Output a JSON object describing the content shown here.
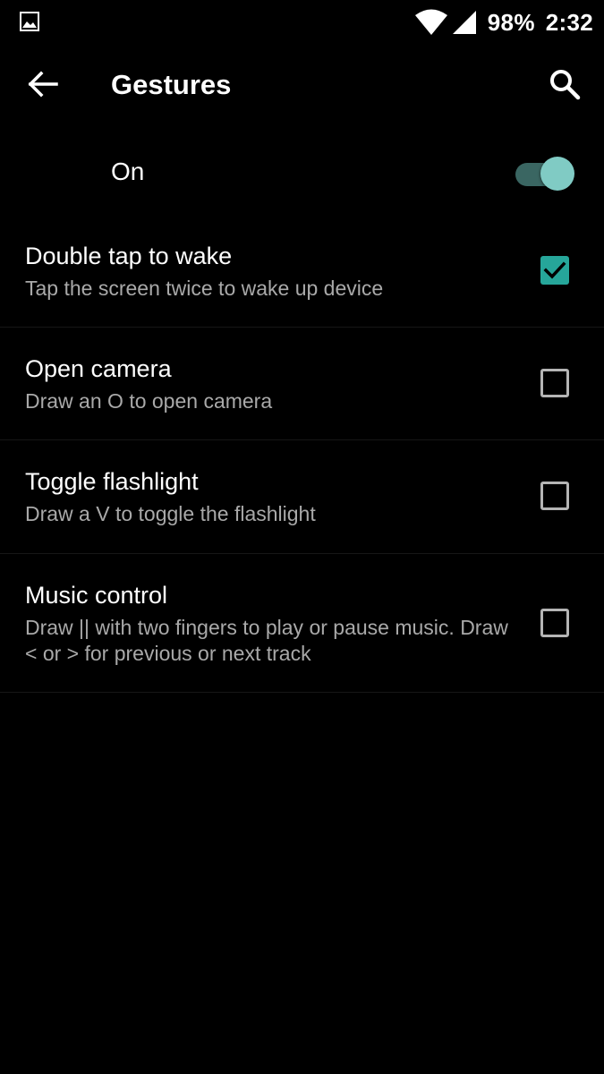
{
  "status_bar": {
    "left_icon": "image-notification-icon",
    "wifi_icon": "wifi-icon",
    "signal_icon": "cell-signal-icon",
    "battery": "98%",
    "time": "2:32"
  },
  "toolbar": {
    "back_icon": "arrow-back-icon",
    "title": "Gestures",
    "search_icon": "search-icon"
  },
  "master_switch": {
    "label": "On",
    "enabled": true
  },
  "settings": [
    {
      "title": "Double tap to wake",
      "summary": "Tap the screen twice to wake up device",
      "checked": true
    },
    {
      "title": "Open camera",
      "summary": "Draw an O to open camera",
      "checked": false
    },
    {
      "title": "Toggle flashlight",
      "summary": "Draw a V to toggle the flashlight",
      "checked": false
    },
    {
      "title": "Music control",
      "summary": "Draw || with two fingers to play or pause music. Draw < or > for previous or next track",
      "checked": false
    }
  ],
  "colors": {
    "background": "#000000",
    "accent": "#80cbc4",
    "checkbox_checked": "#26a69a",
    "summary_text": "#a9a9a9"
  }
}
